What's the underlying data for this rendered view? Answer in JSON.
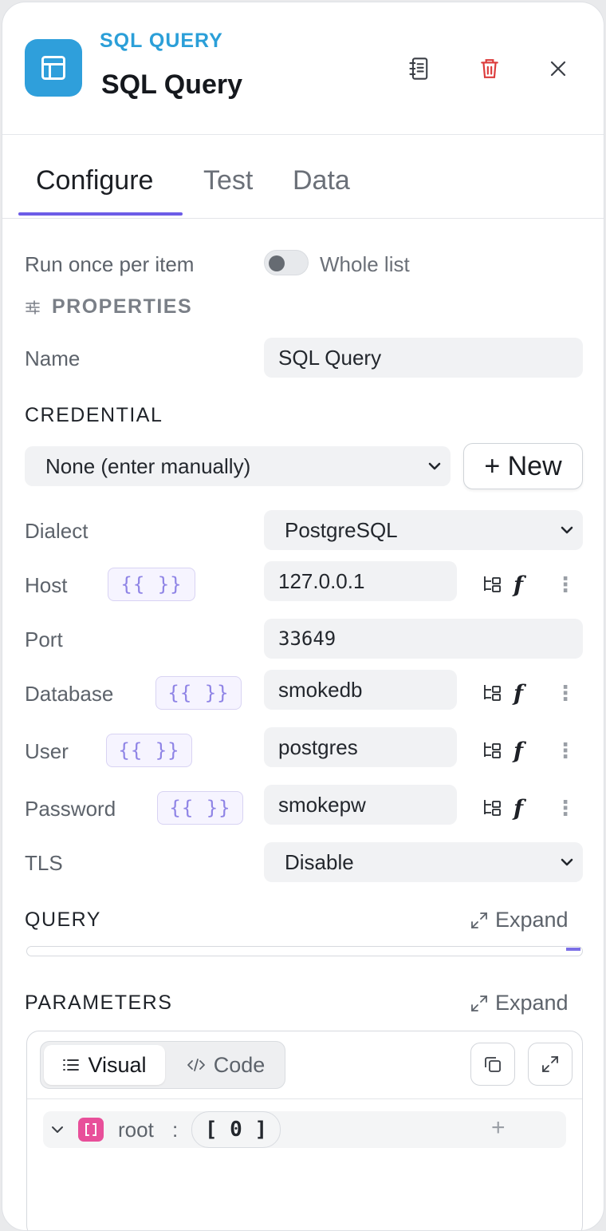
{
  "header": {
    "kind": "SQL QUERY",
    "title": "SQL Query",
    "icons": {
      "node": "table-icon",
      "docs": "notebook-icon",
      "delete": "trash-icon",
      "close": "close-icon"
    }
  },
  "tabs": [
    {
      "label": "Configure",
      "active": true
    },
    {
      "label": "Test",
      "active": false
    },
    {
      "label": "Data",
      "active": false
    }
  ],
  "run_mode": {
    "label": "Run once per item",
    "toggle_label": "Whole list",
    "enabled": false
  },
  "properties": {
    "heading": "PROPERTIES",
    "name": {
      "label": "Name",
      "value": "SQL Query"
    }
  },
  "credential": {
    "heading": "CREDENTIAL",
    "selected": "None (enter manually)",
    "new_button": "+ New"
  },
  "fields": {
    "dialect": {
      "label": "Dialect",
      "value": "PostgreSQL"
    },
    "host": {
      "label": "Host",
      "value": "127.0.0.1"
    },
    "port": {
      "label": "Port",
      "value": "33649"
    },
    "database": {
      "label": "Database",
      "value": "smokedb"
    },
    "user": {
      "label": "User",
      "value": "postgres"
    },
    "password": {
      "label": "Password",
      "value": "smokepw"
    },
    "tls": {
      "label": "TLS",
      "value": "Disable"
    }
  },
  "template_token": "{{ }}",
  "fx_label": "f",
  "query": {
    "heading": "QUERY",
    "expand": "Expand"
  },
  "parameters": {
    "heading": "PARAMETERS",
    "expand": "Expand",
    "modes": {
      "visual": "Visual",
      "code": "Code"
    },
    "root_key": "root",
    "colon": ":",
    "root_value": "[ 0 ]",
    "add": "+"
  },
  "colors": {
    "accent": "#6c5ce7",
    "brand": "#2f9fdb",
    "danger": "#dc3b3b",
    "badge": "#e84f9a"
  }
}
